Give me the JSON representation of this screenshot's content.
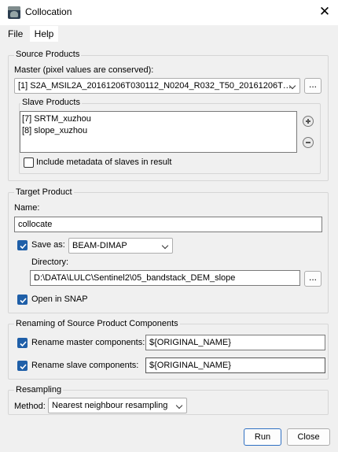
{
  "window": {
    "title": "Collocation",
    "icon": "snap-app-icon",
    "close_glyph": "✕"
  },
  "menu": {
    "file": "File",
    "help": "Help"
  },
  "source_products": {
    "heading": "Source Products",
    "master_label": "Master (pixel values are conserved):",
    "master_value": "[1] S2A_MSIL2A_20161206T030112_N0204_R032_T50_20161206T…",
    "browse_label": "...",
    "slave_heading": "Slave Products",
    "slave_items": [
      "[7] SRTM_xuzhou",
      "[8] slope_xuzhou"
    ],
    "add_icon": "plus-circle-icon",
    "remove_icon": "minus-circle-icon",
    "include_metadata_label": "Include metadata of slaves in result",
    "include_metadata_checked": false
  },
  "target_product": {
    "heading": "Target Product",
    "name_label": "Name:",
    "name_value": "collocate",
    "save_as_label": "Save as:",
    "save_as_checked": true,
    "format_value": "BEAM-DIMAP",
    "directory_label": "Directory:",
    "directory_value": "D:\\DATA\\LULC\\Sentinel2\\05_bandstack_DEM_slope",
    "browse_label": "...",
    "open_in_snap_label": "Open in SNAP",
    "open_in_snap_checked": true
  },
  "renaming": {
    "heading": "Renaming of Source Product Components",
    "master_label": "Rename master components:",
    "master_checked": true,
    "master_value": "${ORIGINAL_NAME}",
    "slave_label": "Rename slave components:",
    "slave_checked": true,
    "slave_value": "${ORIGINAL_NAME}"
  },
  "resampling": {
    "heading": "Resampling",
    "method_label": "Method:",
    "method_value": "Nearest neighbour resampling"
  },
  "buttons": {
    "run": "Run",
    "close": "Close"
  },
  "colors": {
    "accent": "#1f5fa8",
    "focus_border": "#2f70c2",
    "background": "#f0f0f0"
  }
}
